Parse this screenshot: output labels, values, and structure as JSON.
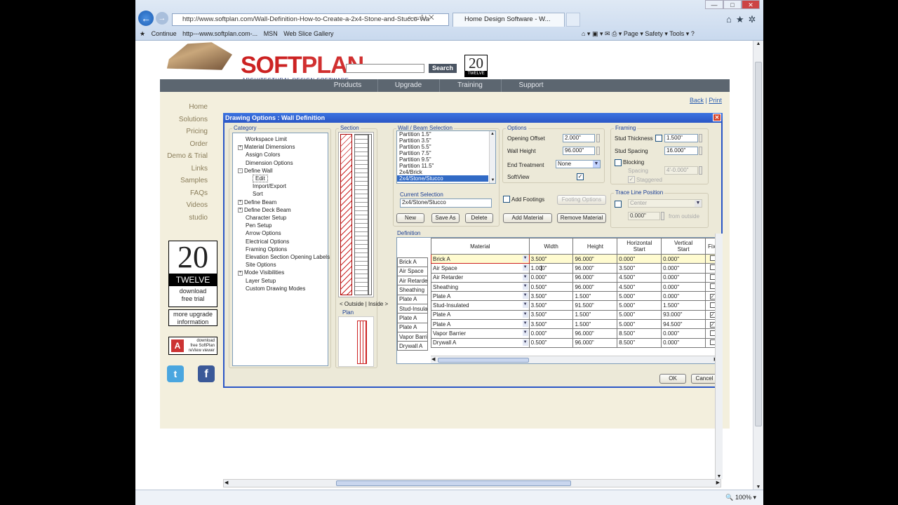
{
  "browser": {
    "address": "http://www.softplan.com/Wall-Definition-How-to-Create-a-2x4-Stone-and-Stucco-Wa",
    "tab_title": "Home Design Software - W...",
    "favorites": [
      "Continue",
      "http---www.softplan.com-...",
      "MSN",
      "Web Slice Gallery"
    ],
    "commands": [
      "Page",
      "Safety",
      "Tools"
    ],
    "zoom": "100%"
  },
  "site": {
    "logo_soft": "SOFT",
    "logo_plan": "PLAN",
    "logo_sub": "ARCHITECTURAL DESIGN SOFTWARE",
    "search_label": "Search",
    "badge_num": "20",
    "badge_text": "TWELVE",
    "nav": [
      "Products",
      "Upgrade",
      "Training",
      "Support"
    ],
    "back": "Back",
    "print": "Print",
    "sep": "|",
    "left_nav": [
      "Home",
      "Solutions",
      "Pricing",
      "Order",
      "Demo & Trial",
      "Links",
      "Samples",
      "FAQs",
      "Videos",
      "studio"
    ],
    "promo_num": "20",
    "promo_text": "TWELVE",
    "promo_dl": "download\nfree trial",
    "upgrade": "more upgrade\ninformation",
    "reviewer": "download\nfree SoftPlan\nreView viewer"
  },
  "dialog": {
    "title": "Drawing Options : Wall Definition",
    "category_label": "Category",
    "tree": [
      {
        "label": "Workspace Limit",
        "level": 1,
        "exp": ""
      },
      {
        "label": "Material Dimensions",
        "level": 1,
        "exp": "+"
      },
      {
        "label": "Assign Colors",
        "level": 1,
        "exp": ""
      },
      {
        "label": "Dimension Options",
        "level": 1,
        "exp": ""
      },
      {
        "label": "Define Wall",
        "level": 1,
        "exp": "-"
      },
      {
        "label": "Edit",
        "level": 2,
        "exp": "",
        "selected": true
      },
      {
        "label": "Import/Export",
        "level": 2,
        "exp": ""
      },
      {
        "label": "Sort",
        "level": 2,
        "exp": ""
      },
      {
        "label": "Define Beam",
        "level": 1,
        "exp": "+"
      },
      {
        "label": "Define Deck Beam",
        "level": 1,
        "exp": "+"
      },
      {
        "label": "Character Setup",
        "level": 1,
        "exp": ""
      },
      {
        "label": "Pen Setup",
        "level": 1,
        "exp": ""
      },
      {
        "label": "Arrow Options",
        "level": 1,
        "exp": ""
      },
      {
        "label": "Electrical Options",
        "level": 1,
        "exp": ""
      },
      {
        "label": "Framing Options",
        "level": 1,
        "exp": ""
      },
      {
        "label": "Elevation Section Opening Labels",
        "level": 1,
        "exp": ""
      },
      {
        "label": "Site Options",
        "level": 1,
        "exp": ""
      },
      {
        "label": "Mode Visibilities",
        "level": 1,
        "exp": "+"
      },
      {
        "label": "Layer Setup",
        "level": 1,
        "exp": ""
      },
      {
        "label": "Custom Drawing Modes",
        "level": 1,
        "exp": ""
      }
    ],
    "section_label": "Section",
    "outside_inside": "< Outside  |  Inside >",
    "plan_label": "Plan",
    "wall_beam_label": "Wall / Beam Selection",
    "walls": [
      "Partition 1.5\"",
      "Partition 3.5\"",
      "Partition 5.5\"",
      "Partition 7.5\"",
      "Partition 9.5\"",
      "Partition 11.5\"",
      "2x4/Brick",
      "2x4/Stone/Stucco"
    ],
    "current_selection_label": "Current Selection",
    "current_selection": "2x4/Stone/Stucco",
    "btn_new": "New",
    "btn_saveas": "Save As",
    "btn_delete": "Delete",
    "options_label": "Options",
    "opening_offset_label": "Opening Offset",
    "opening_offset": "2.000\"",
    "wall_height_label": "Wall Height",
    "wall_height": "96.000\"",
    "end_treatment_label": "End Treatment",
    "end_treatment": "None",
    "softview_label": "SoftView",
    "softview_check": "✓",
    "add_footings_label": "Add Footings",
    "footing_options": "Footing Options",
    "add_material": "Add Material",
    "remove_material": "Remove Material",
    "framing_label": "Framing",
    "stud_thickness_label": "Stud Thickness",
    "stud_thickness": "1.500\"",
    "stud_spacing_label": "Stud Spacing",
    "stud_spacing": "16.000\"",
    "blocking_label": "Blocking",
    "spacing_label": "Spacing",
    "spacing": "4'-0.000\"",
    "staggered_label": "Staggered",
    "staggered_check": "✓",
    "trace_label": "Trace Line Position",
    "trace_pos": "Center",
    "trace_offset": "0.000\"",
    "from_outside": "from outside",
    "definition_label": "Definition",
    "columns": [
      "Material",
      "Width",
      "Height",
      "Horizontal\nStart",
      "Vertical\nStart",
      "Fix"
    ],
    "rows": [
      {
        "label": "Brick A",
        "material": "Brick A",
        "width": "3.500\"",
        "height": "96.000\"",
        "hstart": "0.000\"",
        "vstart": "0.000\"",
        "fix": ""
      },
      {
        "label": "Air Space",
        "material": "Air Space",
        "width": "1.000\"",
        "height": "96.000\"",
        "hstart": "3.500\"",
        "vstart": "0.000\"",
        "fix": ""
      },
      {
        "label": "Air Retarde",
        "material": "Air Retarder",
        "width": "0.000\"",
        "height": "96.000\"",
        "hstart": "4.500\"",
        "vstart": "0.000\"",
        "fix": ""
      },
      {
        "label": "Sheathing",
        "material": "Sheathing",
        "width": "0.500\"",
        "height": "96.000\"",
        "hstart": "4.500\"",
        "vstart": "0.000\"",
        "fix": ""
      },
      {
        "label": "Plate A",
        "material": "Plate A",
        "width": "3.500\"",
        "height": "1.500\"",
        "hstart": "5.000\"",
        "vstart": "0.000\"",
        "fix": "✓"
      },
      {
        "label": "Stud-Insula",
        "material": "Stud-Insulated",
        "width": "3.500\"",
        "height": "91.500\"",
        "hstart": "5.000\"",
        "vstart": "1.500\"",
        "fix": ""
      },
      {
        "label": "Plate A",
        "material": "Plate A",
        "width": "3.500\"",
        "height": "1.500\"",
        "hstart": "5.000\"",
        "vstart": "93.000\"",
        "fix": "✓"
      },
      {
        "label": "Plate A",
        "material": "Plate A",
        "width": "3.500\"",
        "height": "1.500\"",
        "hstart": "5.000\"",
        "vstart": "94.500\"",
        "fix": "✓"
      },
      {
        "label": "Vapor Barri",
        "material": "Vapor Barrier",
        "width": "0.000\"",
        "height": "96.000\"",
        "hstart": "8.500\"",
        "vstart": "0.000\"",
        "fix": ""
      },
      {
        "label": "Drywall A",
        "material": "Drywall A",
        "width": "0.500\"",
        "height": "96.000\"",
        "hstart": "8.500\"",
        "vstart": "0.000\"",
        "fix": ""
      }
    ],
    "ok": "OK",
    "cancel": "Cancel"
  }
}
